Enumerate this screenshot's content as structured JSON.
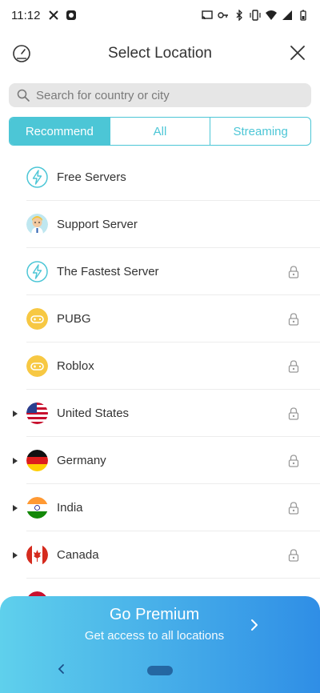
{
  "status_bar": {
    "time": "11:12"
  },
  "header": {
    "title": "Select Location",
    "left_icon": "speedometer-icon",
    "right_icon": "close-icon"
  },
  "search": {
    "placeholder": "Search for country or city",
    "value": ""
  },
  "tabs": [
    {
      "label": "Recommend",
      "active": true
    },
    {
      "label": "All",
      "active": false
    },
    {
      "label": "Streaming",
      "active": false
    }
  ],
  "list": [
    {
      "label": "Free Servers",
      "icon": "lightning-icon",
      "locked": false,
      "expandable": false
    },
    {
      "label": "Support Server",
      "icon": "support-avatar-icon",
      "locked": false,
      "expandable": false
    },
    {
      "label": "The Fastest Server",
      "icon": "lightning-icon",
      "locked": true,
      "expandable": false
    },
    {
      "label": "PUBG",
      "icon": "gamepad-icon",
      "locked": true,
      "expandable": false
    },
    {
      "label": "Roblox",
      "icon": "gamepad-icon",
      "locked": true,
      "expandable": false
    },
    {
      "label": "United States",
      "icon": "us-flag-icon",
      "locked": true,
      "expandable": true
    },
    {
      "label": "Germany",
      "icon": "germany-flag-icon",
      "locked": true,
      "expandable": true
    },
    {
      "label": "India",
      "icon": "india-flag-icon",
      "locked": true,
      "expandable": true
    },
    {
      "label": "Canada",
      "icon": "canada-flag-icon",
      "locked": true,
      "expandable": true
    }
  ],
  "premium": {
    "title": "Go Premium",
    "subtitle": "Get access to all locations"
  },
  "colors": {
    "accent": "#4cc6d6",
    "banner_start": "#5fd0ec",
    "banner_end": "#2f8ee6"
  }
}
